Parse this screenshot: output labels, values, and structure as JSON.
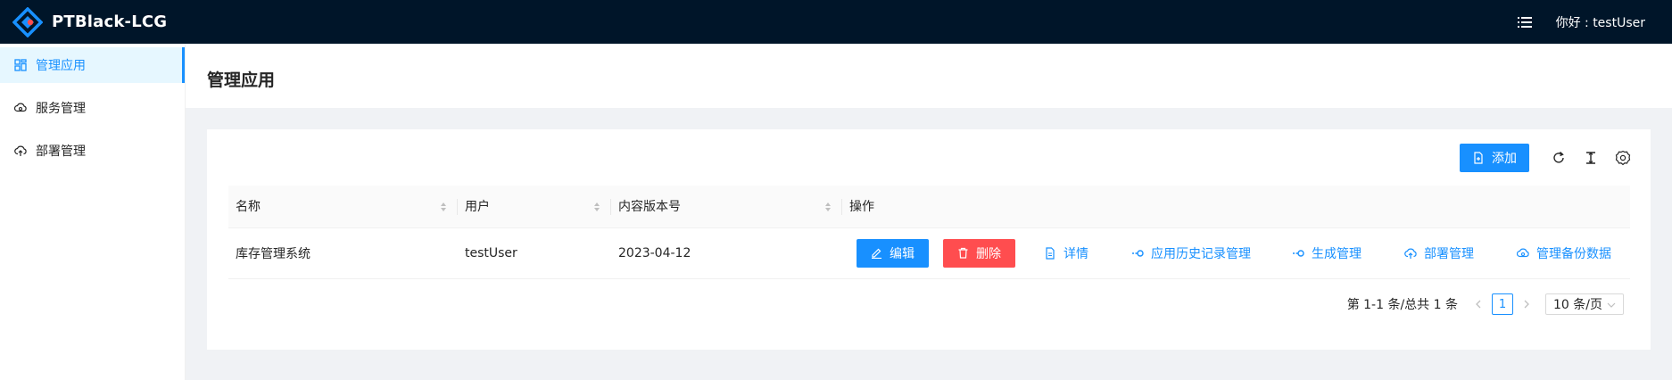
{
  "app": {
    "title": "PTBlack-LCG"
  },
  "header": {
    "greeting": "你好 : testUser"
  },
  "sidebar": {
    "items": [
      {
        "label": "管理应用",
        "icon": "app-icon",
        "active": true
      },
      {
        "label": "服务管理",
        "icon": "cloud-service-icon",
        "active": false
      },
      {
        "label": "部署管理",
        "icon": "cloud-upload-icon",
        "active": false
      }
    ]
  },
  "page": {
    "title": "管理应用"
  },
  "toolbar": {
    "add_label": "添加",
    "icons": [
      "reload-icon",
      "column-height-icon",
      "setting-icon"
    ]
  },
  "table": {
    "columns": [
      "名称",
      "用户",
      "内容版本号",
      "操作"
    ],
    "rows": [
      {
        "name": "库存管理系统",
        "user": "testUser",
        "version": "2023-04-12"
      }
    ],
    "actions": {
      "edit": "编辑",
      "delete": "删除",
      "detail": "详情",
      "history": "应用历史记录管理",
      "build": "生成管理",
      "deploy": "部署管理",
      "backup": "管理备份数据"
    }
  },
  "pagination": {
    "summary": "第 1-1 条/总共 1 条",
    "current_page": "1",
    "page_size": "10 条/页"
  },
  "colors": {
    "header_bg": "#001529",
    "primary": "#1890ff",
    "danger": "#ff4d4f",
    "annotation": "#e1131c"
  }
}
